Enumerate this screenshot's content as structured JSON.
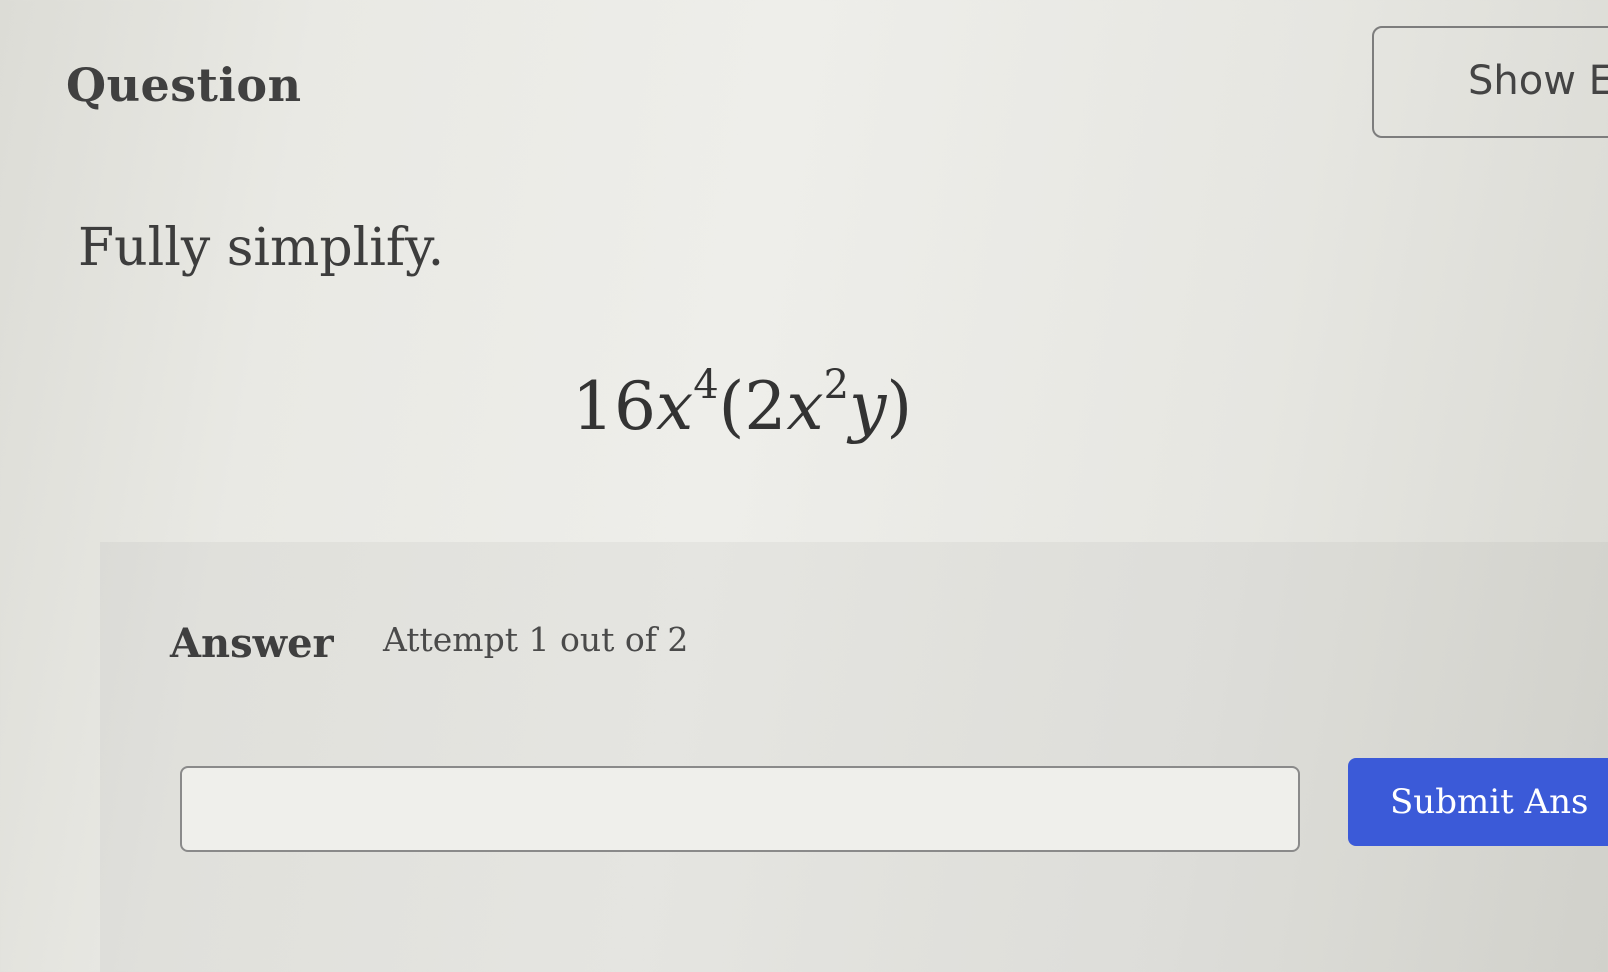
{
  "question": {
    "title": "Question",
    "show_button_label": "Show E",
    "instruction": "Fully simplify."
  },
  "expression": {
    "coef": "16",
    "var1": "x",
    "exp1": "4",
    "open_paren": "(",
    "inner_coef": "2",
    "var2": "x",
    "exp2": "2",
    "var3": "y",
    "close_paren": ")"
  },
  "answer": {
    "label": "Answer",
    "attempt_text": "Attempt 1 out of 2",
    "input_value": "",
    "submit_label": "Submit Ans"
  },
  "colors": {
    "submit_bg": "#3b5ad8",
    "text": "#3d3d3d"
  }
}
